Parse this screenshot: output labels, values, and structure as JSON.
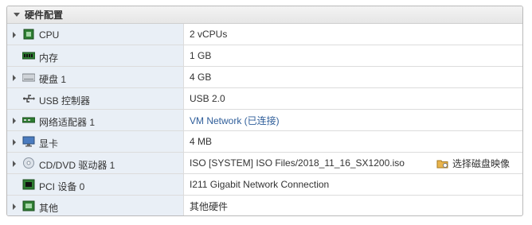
{
  "section": {
    "title": "硬件配置"
  },
  "rows": [
    {
      "name": "CPU",
      "value": "2 vCPUs",
      "expandable": true,
      "icon": "cpu-icon"
    },
    {
      "name": "内存",
      "value": "1 GB",
      "expandable": false,
      "icon": "memory-icon"
    },
    {
      "name": "硬盘 1",
      "value": "4 GB",
      "expandable": true,
      "icon": "hard-disk-icon"
    },
    {
      "name": "USB 控制器",
      "value": "USB 2.0",
      "expandable": false,
      "icon": "usb-icon"
    },
    {
      "name": "网络适配器 1",
      "value": "VM Network (已连接)",
      "expandable": true,
      "icon": "network-adapter-icon"
    },
    {
      "name": "显卡",
      "value": "4 MB",
      "expandable": true,
      "icon": "monitor-icon"
    },
    {
      "name": "CD/DVD 驱动器 1",
      "value": "ISO [SYSTEM] ISO Files/2018_11_16_SX1200.iso",
      "expandable": true,
      "icon": "cd-dvd-icon",
      "action": "选择磁盘映像"
    },
    {
      "name": "PCI 设备 0",
      "value": "I211 Gigabit Network Connection",
      "expandable": false,
      "icon": "pci-device-icon"
    },
    {
      "name": "其他",
      "value": "其他硬件",
      "expandable": true,
      "icon": "other-hardware-icon"
    }
  ],
  "colors": {
    "label_bg": "#e9eff6",
    "link": "#2f5e9a",
    "border": "#b9b9b9"
  }
}
